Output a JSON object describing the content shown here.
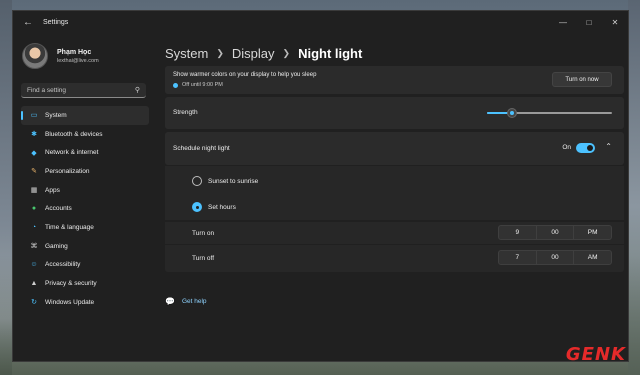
{
  "window": {
    "title": "Settings"
  },
  "user": {
    "name": "Phạm Học",
    "email": "lexthai@live.com"
  },
  "search": {
    "placeholder": "Find a setting"
  },
  "nav": [
    {
      "label": "System",
      "icon": "monitor-icon",
      "color": "#4cc2ff"
    },
    {
      "label": "Bluetooth & devices",
      "icon": "bluetooth-icon",
      "color": "#4cc2ff"
    },
    {
      "label": "Network & internet",
      "icon": "wifi-icon",
      "color": "#4cc2ff"
    },
    {
      "label": "Personalization",
      "icon": "brush-icon",
      "color": "#e8b26a"
    },
    {
      "label": "Apps",
      "icon": "apps-icon",
      "color": "#cfcfcf"
    },
    {
      "label": "Accounts",
      "icon": "person-icon",
      "color": "#48c66e"
    },
    {
      "label": "Time & language",
      "icon": "globe-clock-icon",
      "color": "#4cc2ff"
    },
    {
      "label": "Gaming",
      "icon": "gamepad-icon",
      "color": "#cfcfcf"
    },
    {
      "label": "Accessibility",
      "icon": "accessibility-icon",
      "color": "#4cc2ff"
    },
    {
      "label": "Privacy & security",
      "icon": "shield-icon",
      "color": "#cfcfcf"
    },
    {
      "label": "Windows Update",
      "icon": "update-icon",
      "color": "#4cc2ff"
    }
  ],
  "breadcrumb": {
    "level1": "System",
    "level2": "Display",
    "current": "Night light"
  },
  "night_light": {
    "description": "Show warmer colors on your display to help you sleep",
    "status": "Off until 9:00 PM",
    "turn_on_button": "Turn on now",
    "strength_label": "Strength",
    "strength_value": 0.2,
    "schedule_label": "Schedule night light",
    "schedule_state": "On",
    "option_sunset": "Sunset to sunrise",
    "option_set_hours": "Set hours",
    "turn_on": {
      "label": "Turn on",
      "hour": "9",
      "minute": "00",
      "period": "PM"
    },
    "turn_off": {
      "label": "Turn off",
      "hour": "7",
      "minute": "00",
      "period": "AM"
    }
  },
  "help": {
    "label": "Get help"
  },
  "accent_color": "#4cc2ff",
  "watermark": "GENK"
}
